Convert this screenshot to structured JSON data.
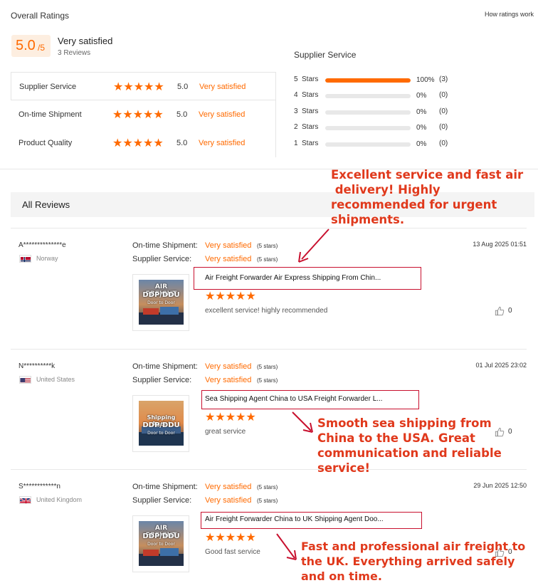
{
  "header": {
    "title": "Overall Ratings",
    "how_link": "How ratings work",
    "score": "5.0",
    "score_of": "/5",
    "summary": "Very satisfied",
    "reviews_count": "3 Reviews"
  },
  "categories": [
    {
      "label": "Supplier Service",
      "stars": "★★★★★",
      "value": "5.0",
      "status": "Very satisfied"
    },
    {
      "label": "On-time Shipment",
      "stars": "★★★★★",
      "value": "5.0",
      "status": "Very satisfied"
    },
    {
      "label": "Product Quality",
      "stars": "★★★★★",
      "value": "5.0",
      "status": "Very satisfied"
    }
  ],
  "distribution": {
    "title": "Supplier Service",
    "rows": [
      {
        "n": "5",
        "label": "Stars",
        "fraction": 1.0,
        "pct": "100%",
        "count": "(3)"
      },
      {
        "n": "4",
        "label": "Stars",
        "fraction": 0,
        "pct": "0%",
        "count": "(0)"
      },
      {
        "n": "3",
        "label": "Stars",
        "fraction": 0,
        "pct": "0%",
        "count": "(0)"
      },
      {
        "n": "2",
        "label": "Stars",
        "fraction": 0,
        "pct": "0%",
        "count": "(0)"
      },
      {
        "n": "1",
        "label": "Stars",
        "fraction": 0,
        "pct": "0%",
        "count": "(0)"
      }
    ]
  },
  "all_reviews_label": "All Reviews",
  "reviews": [
    {
      "name": "A**************e",
      "country": "Norway",
      "flag": "norway",
      "ontime_label": "On-time Shipment:",
      "ontime_status": "Very satisfied",
      "ontime_stars": "(5 stars)",
      "service_label": "Supplier Service:",
      "service_status": "Very satisfied",
      "service_stars": "(5 stars)",
      "date": "13 Aug 2025 01:51",
      "product": "Air Freight Forwarder Air Express Shipping From Chin...",
      "stars": "★★★★★",
      "comment": "excellent service! highly recommended",
      "likes": "0",
      "image": {
        "line1": "AIR FREIGHT",
        "line2": "DDP/DDU",
        "line3": "Door to Door"
      }
    },
    {
      "name": "N**********k",
      "country": "United States",
      "flag": "usa",
      "ontime_label": "On-time Shipment:",
      "ontime_status": "Very satisfied",
      "ontime_stars": "(5 stars)",
      "service_label": "Supplier Service:",
      "service_status": "Very satisfied",
      "service_stars": "(5 stars)",
      "date": "01 Jul 2025 23:02",
      "product": "Sea Shipping Agent China to USA Freight Forwarder L...",
      "stars": "★★★★★",
      "comment": "great service",
      "likes": "0",
      "image": {
        "line1": "Shipping Agent",
        "line2": "DDP/DDU",
        "line3": "Door to Door"
      }
    },
    {
      "name": "S************n",
      "country": "United Kingdom",
      "flag": "uk",
      "ontime_label": "On-time Shipment:",
      "ontime_status": "Very satisfied",
      "ontime_stars": "(5 stars)",
      "service_label": "Supplier Service:",
      "service_status": "Very satisfied",
      "service_stars": "(5 stars)",
      "date": "29 Jun 2025 12:50",
      "product": "Air Freight Forwarder China to UK Shipping Agent Doo...",
      "stars": "★★★★★",
      "comment": "Good fast service",
      "likes": "0",
      "image": {
        "line1": "AIR FREIGHT",
        "line2": "DDP/DDU",
        "line3": "Door to Door"
      }
    }
  ],
  "annotations": [
    "Excellent service and fast air\n delivery! Highly\nrecommended for urgent\nshipments.",
    "Smooth sea shipping from\nChina to the USA. Great\ncommunication and reliable\nservice!",
    "Fast and professional air freight to\nthe UK. Everything arrived safely\nand on time."
  ],
  "colors": {
    "accent": "#ff6a00",
    "annotation": "#e0391c",
    "box": "#c8102e"
  }
}
